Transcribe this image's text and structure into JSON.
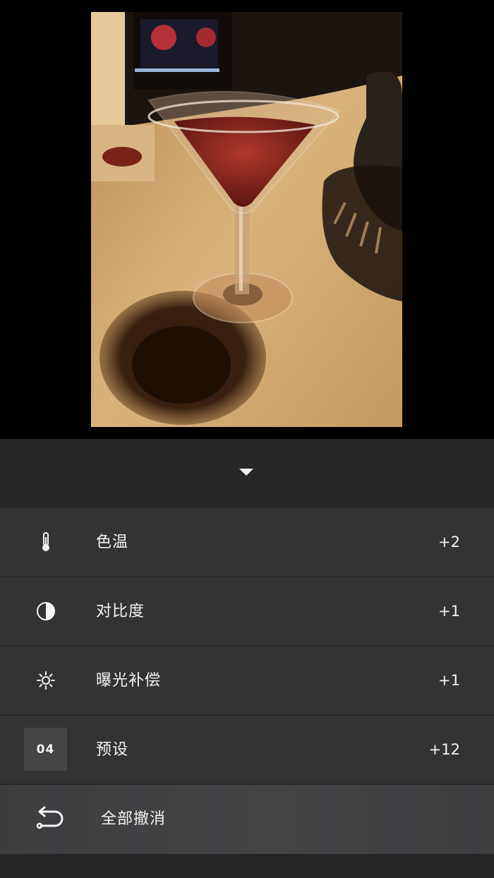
{
  "panel": {
    "collapse_icon": "chevron-down-icon",
    "adjustments": [
      {
        "icon": "thermometer-icon",
        "label": "色温",
        "value": "+2"
      },
      {
        "icon": "contrast-icon",
        "label": "对比度",
        "value": "+1"
      },
      {
        "icon": "sun-icon",
        "label": "曝光补偿",
        "value": "+1"
      },
      {
        "icon": "preset-badge",
        "badge": "04",
        "label": "预设",
        "value": "+12"
      }
    ],
    "undo": {
      "icon": "undo-icon",
      "label": "全部撤消"
    }
  },
  "colors": {
    "panel_bg": "#272729",
    "row_bg": "#333336",
    "text": "#f4f4f4"
  }
}
